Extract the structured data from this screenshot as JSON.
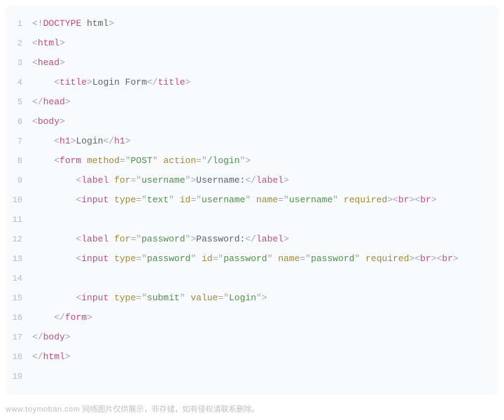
{
  "lines": [
    {
      "n": 1,
      "tokens": [
        {
          "cls": "punct",
          "t": "<!"
        },
        {
          "cls": "doctype-tag",
          "t": "DOCTYPE"
        },
        {
          "cls": "doctype-word",
          "t": " html"
        },
        {
          "cls": "punct",
          "t": ">"
        }
      ]
    },
    {
      "n": 2,
      "tokens": [
        {
          "cls": "punct",
          "t": "<"
        },
        {
          "cls": "tag",
          "t": "html"
        },
        {
          "cls": "punct",
          "t": ">"
        }
      ]
    },
    {
      "n": 3,
      "tokens": [
        {
          "cls": "punct",
          "t": "<"
        },
        {
          "cls": "tag",
          "t": "head"
        },
        {
          "cls": "punct",
          "t": ">"
        }
      ]
    },
    {
      "n": 4,
      "tokens": [
        {
          "cls": "text",
          "t": "    "
        },
        {
          "cls": "punct",
          "t": "<"
        },
        {
          "cls": "tag",
          "t": "title"
        },
        {
          "cls": "punct",
          "t": ">"
        },
        {
          "cls": "text",
          "t": "Login Form"
        },
        {
          "cls": "punct",
          "t": "</"
        },
        {
          "cls": "tag",
          "t": "title"
        },
        {
          "cls": "punct",
          "t": ">"
        }
      ]
    },
    {
      "n": 5,
      "tokens": [
        {
          "cls": "punct",
          "t": "</"
        },
        {
          "cls": "tag",
          "t": "head"
        },
        {
          "cls": "punct",
          "t": ">"
        }
      ]
    },
    {
      "n": 6,
      "tokens": [
        {
          "cls": "punct",
          "t": "<"
        },
        {
          "cls": "tag",
          "t": "body"
        },
        {
          "cls": "punct",
          "t": ">"
        }
      ]
    },
    {
      "n": 7,
      "tokens": [
        {
          "cls": "text",
          "t": "    "
        },
        {
          "cls": "punct",
          "t": "<"
        },
        {
          "cls": "tag",
          "t": "h1"
        },
        {
          "cls": "punct",
          "t": ">"
        },
        {
          "cls": "text",
          "t": "Login"
        },
        {
          "cls": "punct",
          "t": "</"
        },
        {
          "cls": "tag",
          "t": "h1"
        },
        {
          "cls": "punct",
          "t": ">"
        }
      ]
    },
    {
      "n": 8,
      "tokens": [
        {
          "cls": "text",
          "t": "    "
        },
        {
          "cls": "punct",
          "t": "<"
        },
        {
          "cls": "tag",
          "t": "form"
        },
        {
          "cls": "text",
          "t": " "
        },
        {
          "cls": "attr-name",
          "t": "method"
        },
        {
          "cls": "punct",
          "t": "="
        },
        {
          "cls": "punct",
          "t": "\""
        },
        {
          "cls": "attr-val",
          "t": "POST"
        },
        {
          "cls": "punct",
          "t": "\""
        },
        {
          "cls": "text",
          "t": " "
        },
        {
          "cls": "attr-name",
          "t": "action"
        },
        {
          "cls": "punct",
          "t": "="
        },
        {
          "cls": "punct",
          "t": "\""
        },
        {
          "cls": "attr-val",
          "t": "/login"
        },
        {
          "cls": "punct",
          "t": "\""
        },
        {
          "cls": "punct",
          "t": ">"
        }
      ]
    },
    {
      "n": 9,
      "tokens": [
        {
          "cls": "text",
          "t": "        "
        },
        {
          "cls": "punct",
          "t": "<"
        },
        {
          "cls": "tag",
          "t": "label"
        },
        {
          "cls": "text",
          "t": " "
        },
        {
          "cls": "attr-name",
          "t": "for"
        },
        {
          "cls": "punct",
          "t": "="
        },
        {
          "cls": "punct",
          "t": "\""
        },
        {
          "cls": "attr-val",
          "t": "username"
        },
        {
          "cls": "punct",
          "t": "\""
        },
        {
          "cls": "punct",
          "t": ">"
        },
        {
          "cls": "text",
          "t": "Username:"
        },
        {
          "cls": "punct",
          "t": "</"
        },
        {
          "cls": "tag",
          "t": "label"
        },
        {
          "cls": "punct",
          "t": ">"
        }
      ]
    },
    {
      "n": 10,
      "tokens": [
        {
          "cls": "text",
          "t": "        "
        },
        {
          "cls": "punct",
          "t": "<"
        },
        {
          "cls": "tag",
          "t": "input"
        },
        {
          "cls": "text",
          "t": " "
        },
        {
          "cls": "attr-name",
          "t": "type"
        },
        {
          "cls": "punct",
          "t": "="
        },
        {
          "cls": "punct",
          "t": "\""
        },
        {
          "cls": "attr-val",
          "t": "text"
        },
        {
          "cls": "punct",
          "t": "\""
        },
        {
          "cls": "text",
          "t": " "
        },
        {
          "cls": "attr-name",
          "t": "id"
        },
        {
          "cls": "punct",
          "t": "="
        },
        {
          "cls": "punct",
          "t": "\""
        },
        {
          "cls": "attr-val",
          "t": "username"
        },
        {
          "cls": "punct",
          "t": "\""
        },
        {
          "cls": "text",
          "t": " "
        },
        {
          "cls": "attr-name",
          "t": "name"
        },
        {
          "cls": "punct",
          "t": "="
        },
        {
          "cls": "punct",
          "t": "\""
        },
        {
          "cls": "attr-val",
          "t": "username"
        },
        {
          "cls": "punct",
          "t": "\""
        },
        {
          "cls": "text",
          "t": " "
        },
        {
          "cls": "attr-name",
          "t": "required"
        },
        {
          "cls": "punct",
          "t": ">"
        },
        {
          "cls": "punct",
          "t": "<"
        },
        {
          "cls": "tag",
          "t": "br"
        },
        {
          "cls": "punct",
          "t": ">"
        },
        {
          "cls": "punct",
          "t": "<"
        },
        {
          "cls": "tag",
          "t": "br"
        },
        {
          "cls": "punct",
          "t": ">"
        }
      ]
    },
    {
      "n": 11,
      "tokens": []
    },
    {
      "n": 12,
      "tokens": [
        {
          "cls": "text",
          "t": "        "
        },
        {
          "cls": "punct",
          "t": "<"
        },
        {
          "cls": "tag",
          "t": "label"
        },
        {
          "cls": "text",
          "t": " "
        },
        {
          "cls": "attr-name",
          "t": "for"
        },
        {
          "cls": "punct",
          "t": "="
        },
        {
          "cls": "punct",
          "t": "\""
        },
        {
          "cls": "attr-val",
          "t": "password"
        },
        {
          "cls": "punct",
          "t": "\""
        },
        {
          "cls": "punct",
          "t": ">"
        },
        {
          "cls": "text",
          "t": "Password:"
        },
        {
          "cls": "punct",
          "t": "</"
        },
        {
          "cls": "tag",
          "t": "label"
        },
        {
          "cls": "punct",
          "t": ">"
        }
      ]
    },
    {
      "n": 13,
      "tokens": [
        {
          "cls": "text",
          "t": "        "
        },
        {
          "cls": "punct",
          "t": "<"
        },
        {
          "cls": "tag",
          "t": "input"
        },
        {
          "cls": "text",
          "t": " "
        },
        {
          "cls": "attr-name",
          "t": "type"
        },
        {
          "cls": "punct",
          "t": "="
        },
        {
          "cls": "punct",
          "t": "\""
        },
        {
          "cls": "attr-val",
          "t": "password"
        },
        {
          "cls": "punct",
          "t": "\""
        },
        {
          "cls": "text",
          "t": " "
        },
        {
          "cls": "attr-name",
          "t": "id"
        },
        {
          "cls": "punct",
          "t": "="
        },
        {
          "cls": "punct",
          "t": "\""
        },
        {
          "cls": "attr-val",
          "t": "password"
        },
        {
          "cls": "punct",
          "t": "\""
        },
        {
          "cls": "text",
          "t": " "
        },
        {
          "cls": "attr-name",
          "t": "name"
        },
        {
          "cls": "punct",
          "t": "="
        },
        {
          "cls": "punct",
          "t": "\""
        },
        {
          "cls": "attr-val",
          "t": "password"
        },
        {
          "cls": "punct",
          "t": "\""
        },
        {
          "cls": "text",
          "t": " "
        },
        {
          "cls": "attr-name",
          "t": "required"
        },
        {
          "cls": "punct",
          "t": ">"
        },
        {
          "cls": "punct",
          "t": "<"
        },
        {
          "cls": "tag",
          "t": "br"
        },
        {
          "cls": "punct",
          "t": ">"
        },
        {
          "cls": "punct",
          "t": "<"
        },
        {
          "cls": "tag",
          "t": "br"
        },
        {
          "cls": "punct",
          "t": ">"
        }
      ]
    },
    {
      "n": 14,
      "tokens": []
    },
    {
      "n": 15,
      "tokens": [
        {
          "cls": "text",
          "t": "        "
        },
        {
          "cls": "punct",
          "t": "<"
        },
        {
          "cls": "tag",
          "t": "input"
        },
        {
          "cls": "text",
          "t": " "
        },
        {
          "cls": "attr-name",
          "t": "type"
        },
        {
          "cls": "punct",
          "t": "="
        },
        {
          "cls": "punct",
          "t": "\""
        },
        {
          "cls": "attr-val",
          "t": "submit"
        },
        {
          "cls": "punct",
          "t": "\""
        },
        {
          "cls": "text",
          "t": " "
        },
        {
          "cls": "attr-name",
          "t": "value"
        },
        {
          "cls": "punct",
          "t": "="
        },
        {
          "cls": "punct",
          "t": "\""
        },
        {
          "cls": "attr-val",
          "t": "Login"
        },
        {
          "cls": "punct",
          "t": "\""
        },
        {
          "cls": "punct",
          "t": ">"
        }
      ]
    },
    {
      "n": 16,
      "tokens": [
        {
          "cls": "text",
          "t": "    "
        },
        {
          "cls": "punct",
          "t": "</"
        },
        {
          "cls": "tag",
          "t": "form"
        },
        {
          "cls": "punct",
          "t": ">"
        }
      ]
    },
    {
      "n": 17,
      "tokens": [
        {
          "cls": "punct",
          "t": "</"
        },
        {
          "cls": "tag",
          "t": "body"
        },
        {
          "cls": "punct",
          "t": ">"
        }
      ]
    },
    {
      "n": 18,
      "tokens": [
        {
          "cls": "punct",
          "t": "</"
        },
        {
          "cls": "tag",
          "t": "html"
        },
        {
          "cls": "punct",
          "t": ">"
        }
      ]
    },
    {
      "n": 19,
      "tokens": []
    }
  ],
  "footer": {
    "domain": "www.toymoban.com",
    "note": "网络图片仅供展示，非存储，如有侵权请联系删除。"
  }
}
